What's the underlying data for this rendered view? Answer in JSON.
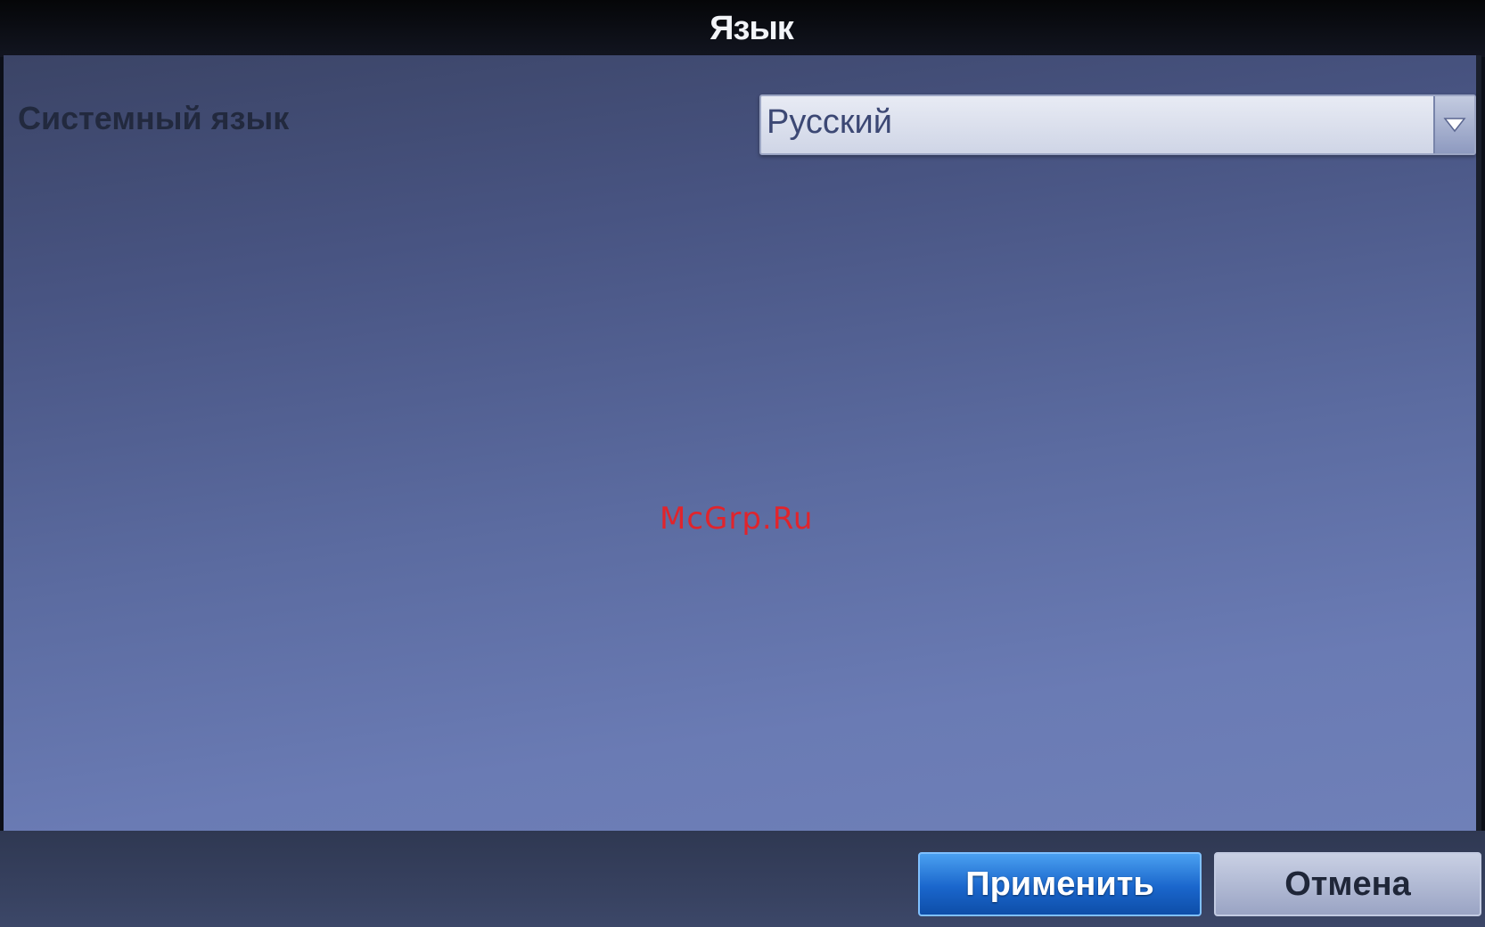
{
  "dialog": {
    "title": "Язык"
  },
  "settings": {
    "system_language_label": "Системный язык",
    "system_language_value": "Русский"
  },
  "watermark": "McGrp.Ru",
  "buttons": {
    "apply_label": "Применить",
    "cancel_label": "Отмена"
  },
  "colors": {
    "apply_button": "#1a66cc",
    "watermark": "#e0242c"
  },
  "icons": {
    "dropdown": "chevron-down-icon"
  }
}
